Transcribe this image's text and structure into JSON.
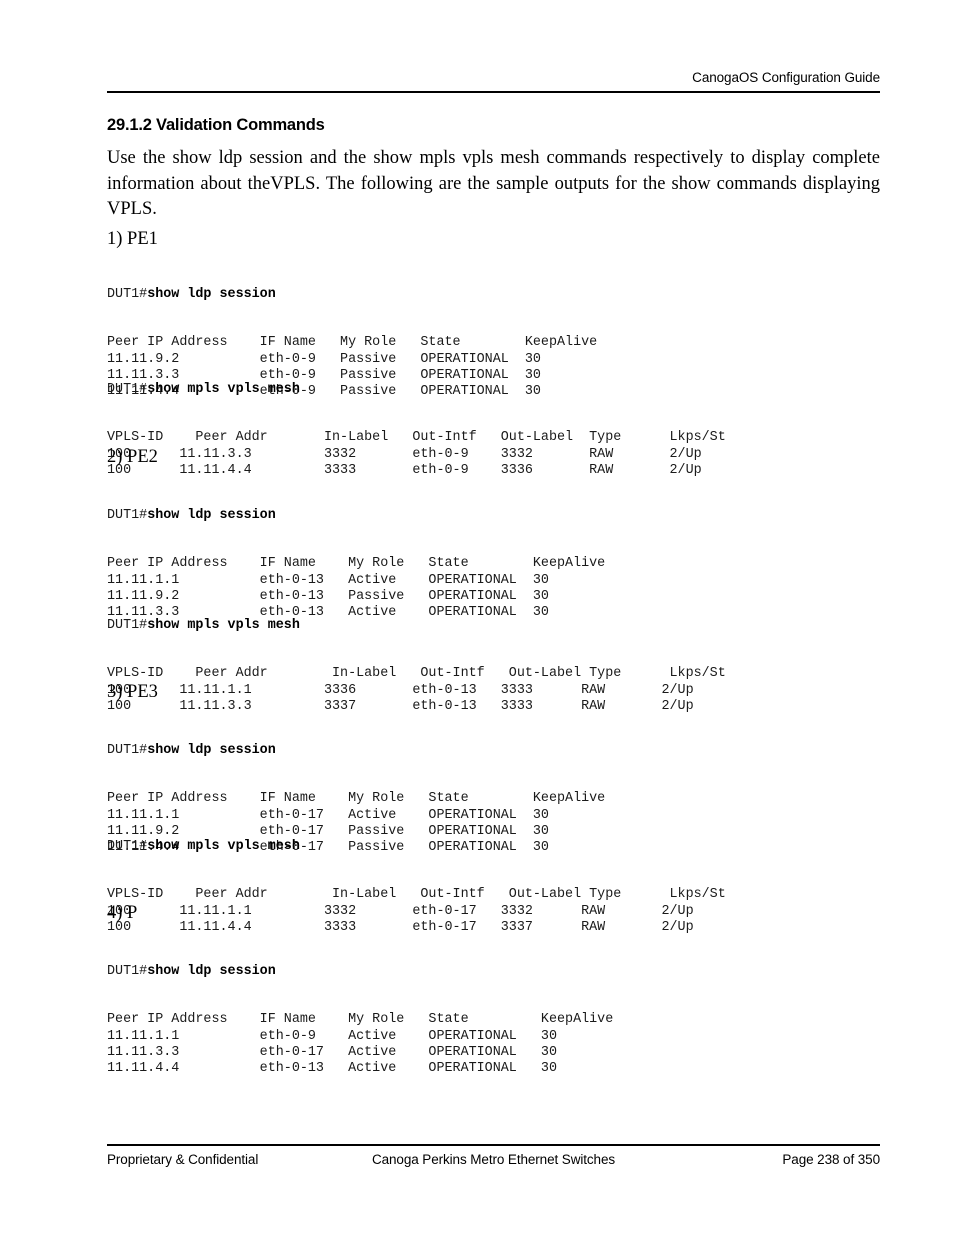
{
  "header": {
    "title": "CanogaOS Configuration Guide"
  },
  "section": {
    "heading": "29.1.2 Validation Commands",
    "paragraph": "Use the show ldp session and the show mpls vpls mesh commands respectively to display complete information about theVPLS. The following are the sample outputs for the show commands displaying VPLS."
  },
  "items": [
    {
      "label": "1) PE1",
      "blocks": [
        {
          "prompt": "DUT1#",
          "command": "show ldp session",
          "output": "Peer IP Address    IF Name   My Role   State        KeepAlive\n11.11.9.2          eth-0-9   Passive   OPERATIONAL  30\n11.11.3.3          eth-0-9   Passive   OPERATIONAL  30\n11.11.4.4          eth-0-9   Passive   OPERATIONAL  30"
        },
        {
          "prompt": "DUT1#",
          "command": "show mpls vpls mesh",
          "output": "VPLS-ID    Peer Addr       In-Label   Out-Intf   Out-Label  Type      Lkps/St\n100      11.11.3.3         3332       eth-0-9    3332       RAW       2/Up\n100      11.11.4.4         3333       eth-0-9    3336       RAW       2/Up"
        }
      ]
    },
    {
      "label": "2) PE2",
      "blocks": [
        {
          "prompt": "DUT1#",
          "command": "show ldp session",
          "output": "Peer IP Address    IF Name    My Role   State        KeepAlive\n11.11.1.1          eth-0-13   Active    OPERATIONAL  30\n11.11.9.2          eth-0-13   Passive   OPERATIONAL  30\n11.11.3.3          eth-0-13   Active    OPERATIONAL  30"
        },
        {
          "prompt": "DUT1#",
          "command": "show mpls vpls mesh",
          "output": "VPLS-ID    Peer Addr        In-Label   Out-Intf   Out-Label Type      Lkps/St\n100      11.11.1.1         3336       eth-0-13   3333      RAW       2/Up\n100      11.11.3.3         3337       eth-0-13   3333      RAW       2/Up"
        }
      ]
    },
    {
      "label": "3) PE3",
      "blocks": [
        {
          "prompt": "DUT1#",
          "command": "show ldp session",
          "output": "Peer IP Address    IF Name    My Role   State        KeepAlive\n11.11.1.1          eth-0-17   Active    OPERATIONAL  30\n11.11.9.2          eth-0-17   Passive   OPERATIONAL  30\n11.11.4.4          eth-0-17   Passive   OPERATIONAL  30"
        },
        {
          "prompt": "DUT1#",
          "command": "show mpls vpls mesh",
          "output": "VPLS-ID    Peer Addr        In-Label   Out-Intf   Out-Label Type      Lkps/St\n100      11.11.1.1         3332       eth-0-17   3332      RAW       2/Up\n100      11.11.4.4         3333       eth-0-17   3337      RAW       2/Up"
        }
      ]
    },
    {
      "label": "4) P",
      "blocks": [
        {
          "prompt": "DUT1#",
          "command": "show ldp session",
          "output": "Peer IP Address    IF Name    My Role   State         KeepAlive\n11.11.1.1          eth-0-9    Active    OPERATIONAL   30\n11.11.3.3          eth-0-17   Active    OPERATIONAL   30\n11.11.4.4          eth-0-13   Active    OPERATIONAL   30"
        }
      ]
    }
  ],
  "footer": {
    "left": "Proprietary & Confidential",
    "center": "Canoga Perkins Metro Ethernet Switches",
    "right": "Page 238 of 350"
  }
}
